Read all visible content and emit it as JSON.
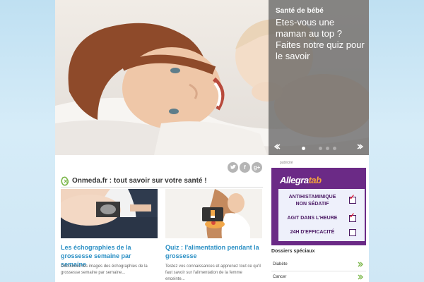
{
  "hero": {
    "category": "Santé de bébé",
    "title": "Etes-vous une maman au top ? Faites notre quiz pour le savoir",
    "slides": {
      "count": 4,
      "active": 1
    }
  },
  "share": {
    "icons": [
      "twitter-icon",
      "facebook-icon",
      "google-plus-icon"
    ],
    "labels": {
      "facebook": "f",
      "google_plus": "g+"
    }
  },
  "main": {
    "heading": "Onmeda.fr : tout savoir sur votre santé !",
    "cards": [
      {
        "title": "Les échographies de la grossesse semaine par semaine",
        "description": "Découvrez les images des échographies de la grossesse semaine par semaine..."
      },
      {
        "title": "Quiz : l'alimentation pendant la grossesse",
        "description": "Testez vos connaissances et apprenez tout ce qu'il faut savoir sur l'alimentation de la femme enceinte..."
      }
    ]
  },
  "ad": {
    "label": "publicité",
    "brand": {
      "part1": "Allegra",
      "part2": "tab"
    },
    "lines": [
      "ANTIHISTAMINIQUE",
      "NON SÉDATIF",
      "AGIT DANS L'HEURE",
      "24H D'EFFICACITÉ"
    ],
    "colors": {
      "background": "#6b2a86",
      "panel": "#eef0fb",
      "check": "#e0203a"
    }
  },
  "sidebar": {
    "title": "Dossiers spéciaux",
    "items": [
      {
        "label": "Diabète"
      },
      {
        "label": "Cancer"
      }
    ],
    "chevron_color": "#7ab648"
  },
  "colors": {
    "link": "#2a8fc4",
    "accent_green": "#7ab648"
  }
}
